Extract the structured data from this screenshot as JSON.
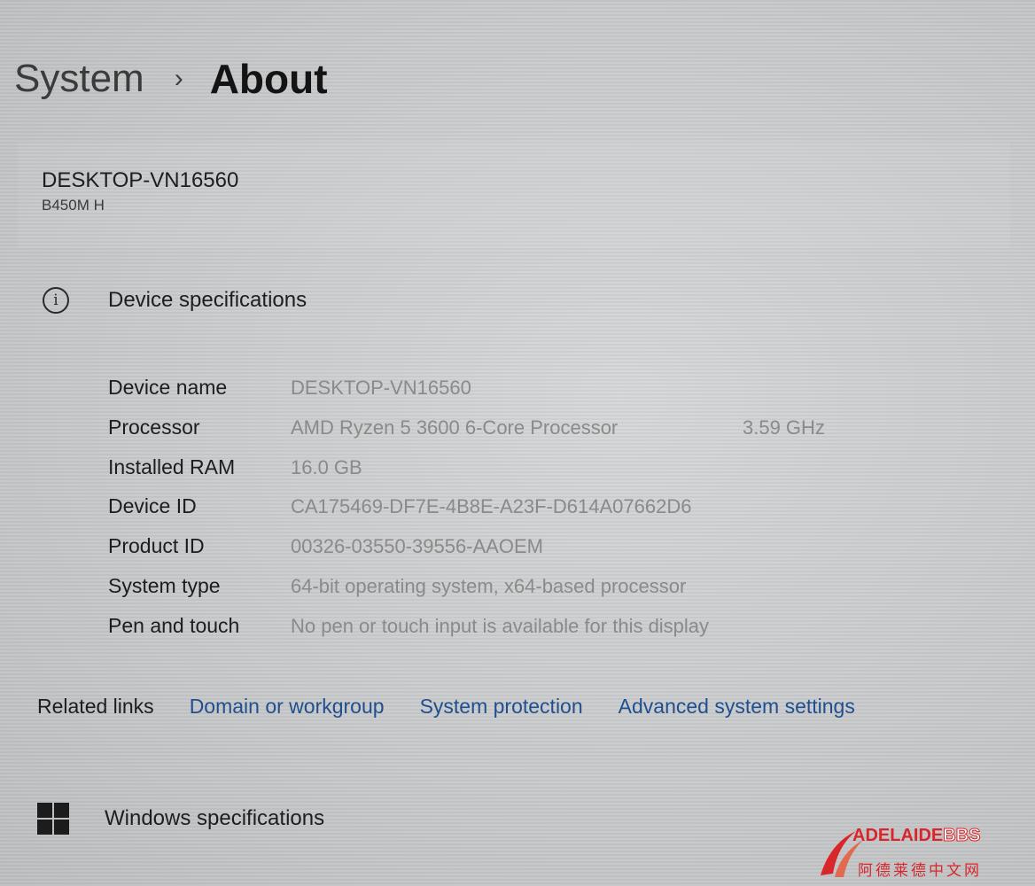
{
  "breadcrumb": {
    "parent": "System",
    "separator": "›",
    "current": "About"
  },
  "device": {
    "name": "DESKTOP-VN16560",
    "model": "B450M H"
  },
  "device_specs": {
    "icon": "info-icon",
    "header": "Device specifications",
    "rows": [
      {
        "label": "Device name",
        "value": "DESKTOP-VN16560",
        "extra": ""
      },
      {
        "label": "Processor",
        "value": "AMD Ryzen 5 3600 6-Core Processor",
        "extra": "3.59 GHz"
      },
      {
        "label": "Installed RAM",
        "value": "16.0 GB",
        "extra": ""
      },
      {
        "label": "Device ID",
        "value": "CA175469-DF7E-4B8E-A23F-D614A07662D6",
        "extra": ""
      },
      {
        "label": "Product ID",
        "value": "00326-03550-39556-AAOEM",
        "extra": ""
      },
      {
        "label": "System type",
        "value": "64-bit operating system, x64-based processor",
        "extra": ""
      },
      {
        "label": "Pen and touch",
        "value": "No pen or touch input is available for this display",
        "extra": ""
      }
    ]
  },
  "related_links": {
    "label": "Related links",
    "links": [
      "Domain or workgroup",
      "System protection",
      "Advanced system settings"
    ],
    "link_color": "#1f4f8f"
  },
  "windows_specs": {
    "icon": "windows-logo-icon",
    "header": "Windows specifications"
  },
  "watermark": {
    "top_text": "ADELAIDE",
    "top_text_suffix": "BBS",
    "bottom_text": "阿德莱德中文网",
    "color": "#d8262b"
  }
}
